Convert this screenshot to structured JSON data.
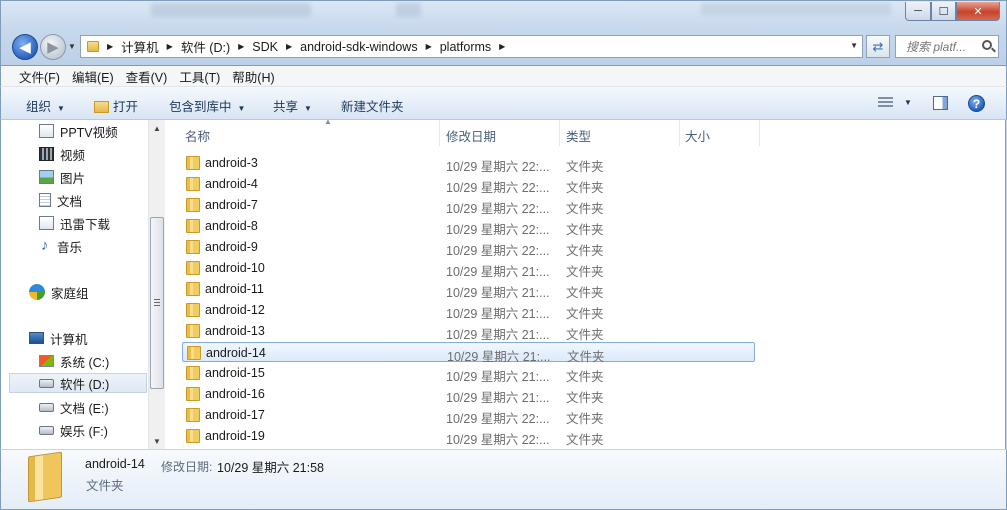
{
  "window": {
    "min_label": "─",
    "max_label": "☐",
    "close_label": "✕"
  },
  "nav": {
    "back_glyph": "◀",
    "forward_glyph": "▶"
  },
  "address": {
    "crumbs": [
      "计算机",
      "软件 (D:)",
      "SDK",
      "android-sdk-windows",
      "platforms"
    ]
  },
  "search": {
    "placeholder": "搜索 platf..."
  },
  "menu": [
    "文件(F)",
    "编辑(E)",
    "查看(V)",
    "工具(T)",
    "帮助(H)"
  ],
  "toolbar": {
    "organize": "组织",
    "open": "打开",
    "include_library": "包含到库中",
    "share": "共享",
    "new_folder": "新建文件夹"
  },
  "sidebar": {
    "items": [
      {
        "label": "PPTV视频",
        "icon": "pptv-icon"
      },
      {
        "label": "视频",
        "icon": "video-icon"
      },
      {
        "label": "图片",
        "icon": "pictures-icon"
      },
      {
        "label": "文档",
        "icon": "documents-icon"
      },
      {
        "label": "迅雷下载",
        "icon": "xunlei-icon"
      },
      {
        "label": "音乐",
        "icon": "music-icon"
      },
      {
        "label": "家庭组",
        "icon": "homegroup-icon"
      },
      {
        "label": "计算机",
        "icon": "computer-icon"
      },
      {
        "label": "系统 (C:)",
        "icon": "windows-drive-icon"
      },
      {
        "label": "软件 (D:)",
        "icon": "drive-icon",
        "selected": true
      },
      {
        "label": "文档 (E:)",
        "icon": "drive-icon"
      },
      {
        "label": "娱乐 (F:)",
        "icon": "drive-icon"
      }
    ]
  },
  "columns": {
    "name": "名称",
    "date": "修改日期",
    "type": "类型",
    "size": "大小"
  },
  "files": [
    {
      "name": "android-3",
      "date": "10/29 星期六 22:...",
      "type": "文件夹"
    },
    {
      "name": "android-4",
      "date": "10/29 星期六 22:...",
      "type": "文件夹"
    },
    {
      "name": "android-7",
      "date": "10/29 星期六 22:...",
      "type": "文件夹"
    },
    {
      "name": "android-8",
      "date": "10/29 星期六 22:...",
      "type": "文件夹"
    },
    {
      "name": "android-9",
      "date": "10/29 星期六 22:...",
      "type": "文件夹"
    },
    {
      "name": "android-10",
      "date": "10/29 星期六 21:...",
      "type": "文件夹"
    },
    {
      "name": "android-11",
      "date": "10/29 星期六 21:...",
      "type": "文件夹"
    },
    {
      "name": "android-12",
      "date": "10/29 星期六 21:...",
      "type": "文件夹"
    },
    {
      "name": "android-13",
      "date": "10/29 星期六 21:...",
      "type": "文件夹"
    },
    {
      "name": "android-14",
      "date": "10/29 星期六 21:...",
      "type": "文件夹",
      "selected": true
    },
    {
      "name": "android-15",
      "date": "10/29 星期六 21:...",
      "type": "文件夹"
    },
    {
      "name": "android-16",
      "date": "10/29 星期六 21:...",
      "type": "文件夹"
    },
    {
      "name": "android-17",
      "date": "10/29 星期六 22:...",
      "type": "文件夹"
    },
    {
      "name": "android-19",
      "date": "10/29 星期六 22:...",
      "type": "文件夹"
    }
  ],
  "details": {
    "name": "android-14",
    "modified_label": "修改日期:",
    "modified_value": "10/29 星期六 21:58",
    "type": "文件夹"
  }
}
